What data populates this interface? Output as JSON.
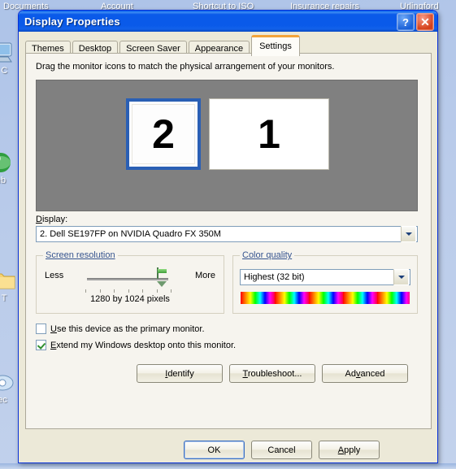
{
  "desktop": {
    "top_labels": [
      "Documents",
      "Account",
      "Shortcut to ISO",
      "Insurance repairs",
      "Urlingford"
    ],
    "left_icons": [
      {
        "name": "my-computer",
        "caption": "y C"
      },
      {
        "name": "internet-explorer",
        "caption": "eb"
      },
      {
        "name": "folder",
        "caption": "T"
      },
      {
        "name": "media-player",
        "caption": "ec"
      }
    ]
  },
  "dialog": {
    "title": "Display Properties",
    "help_button": "?",
    "close_button": "✕",
    "tabs": [
      {
        "label": "Themes",
        "active": false
      },
      {
        "label": "Desktop",
        "active": false
      },
      {
        "label": "Screen Saver",
        "active": false
      },
      {
        "label": "Appearance",
        "active": false
      },
      {
        "label": "Settings",
        "active": true
      }
    ],
    "settings": {
      "hint": "Drag the monitor icons to match the physical arrangement of your monitors.",
      "monitors": [
        {
          "number": "2",
          "selected": true
        },
        {
          "number": "1",
          "selected": false
        }
      ],
      "display_label": "Display:",
      "display_value": "2. Dell SE197FP on NVIDIA Quadro FX 350M",
      "screen_resolution": {
        "legend": "Screen resolution",
        "less": "Less",
        "more": "More",
        "value": "1280 by 1024 pixels"
      },
      "color_quality": {
        "legend": "Color quality",
        "value": "Highest (32 bit)"
      },
      "checkboxes": [
        {
          "label": "Use this device as the primary monitor.",
          "checked": false
        },
        {
          "label": "Extend my Windows desktop onto this monitor.",
          "checked": true
        }
      ],
      "buttons": [
        {
          "label": "Identify"
        },
        {
          "label": "Troubleshoot..."
        },
        {
          "label": "Advanced"
        }
      ]
    },
    "footer_buttons": [
      {
        "label": "OK",
        "default": true
      },
      {
        "label": "Cancel",
        "default": false
      },
      {
        "label": "Apply",
        "default": false
      }
    ]
  },
  "colors": {
    "titlebar_blue": "#0a5ae9",
    "tab_active_accent": "#f3a43b",
    "dialog_face": "#ece9d8",
    "panel_face": "#f6f4ee",
    "preview_gray": "#808080",
    "monitor_selected_border": "#2a5fb4",
    "group_legend": "#36548f"
  }
}
